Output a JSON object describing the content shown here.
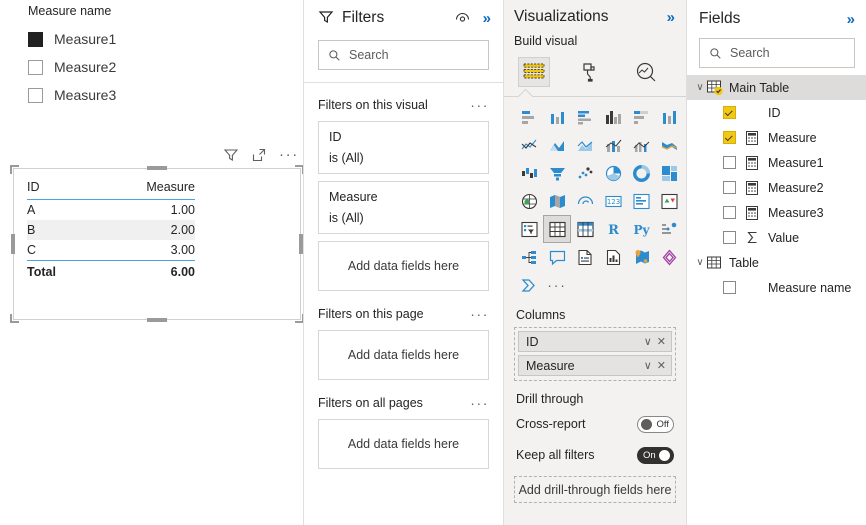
{
  "canvas": {
    "slicer": {
      "title": "Measure name",
      "items": [
        {
          "label": "Measure1",
          "checked": true
        },
        {
          "label": "Measure2",
          "checked": false
        },
        {
          "label": "Measure3",
          "checked": false
        }
      ]
    },
    "visual_header": {
      "filter_icon": "filter-icon",
      "focus_icon": "focus-mode-icon",
      "more_label": "···"
    },
    "table_visual": {
      "columns": [
        "ID",
        "Measure"
      ],
      "rows": [
        {
          "id": "A",
          "measure": "1.00"
        },
        {
          "id": "B",
          "measure": "2.00"
        },
        {
          "id": "C",
          "measure": "3.00"
        }
      ],
      "total": {
        "id": "Total",
        "measure": "6.00"
      }
    }
  },
  "filters": {
    "title": "Filters",
    "hide_icon": "eye-icon",
    "collapse_icon": "»",
    "search": {
      "placeholder": "Search"
    },
    "groups": [
      {
        "title": "Filters on this visual",
        "menu": "···",
        "cards": [
          {
            "field": "ID",
            "condition": "is (All)"
          },
          {
            "field": "Measure",
            "condition": "is (All)"
          }
        ],
        "dropzone": "Add data fields here"
      },
      {
        "title": "Filters on this page",
        "menu": "···",
        "cards": [],
        "dropzone": "Add data fields here"
      },
      {
        "title": "Filters on all pages",
        "menu": "···",
        "cards": [],
        "dropzone": "Add data fields here"
      }
    ]
  },
  "visualizations": {
    "title": "Visualizations",
    "collapse_icon": "»",
    "build_label": "Build visual",
    "tabs": [
      {
        "name": "build-visual-tab",
        "icon": "table-fields-icon",
        "selected": true
      },
      {
        "name": "format-visual-tab",
        "icon": "paint-roller-icon",
        "selected": false
      },
      {
        "name": "analytics-tab",
        "icon": "magnifier-chart-icon",
        "selected": false
      }
    ],
    "visual_types": [
      "stacked-bar-chart-icon",
      "stacked-column-chart-icon",
      "clustered-bar-chart-icon",
      "clustered-column-chart-icon",
      "hundred-percent-stacked-bar-chart-icon",
      "hundred-percent-stacked-column-chart-icon",
      "line-chart-icon",
      "area-chart-icon",
      "stacked-area-chart-icon",
      "line-stacked-column-chart-icon",
      "line-clustered-column-chart-icon",
      "ribbon-chart-icon",
      "waterfall-chart-icon",
      "funnel-chart-icon",
      "scatter-chart-icon",
      "pie-chart-icon",
      "donut-chart-icon",
      "treemap-icon",
      "map-icon",
      "filled-map-icon",
      "azure-map-icon",
      "card-icon",
      "multi-row-card-icon",
      "kpi-icon",
      "slicer-icon",
      "table-icon",
      "matrix-icon",
      "r-script-visual-icon",
      "python-visual-icon",
      "key-influencers-icon",
      "decomposition-tree-icon",
      "qna-icon",
      "smart-narrative-icon",
      "paginated-report-icon",
      "arcgis-map-icon",
      "power-apps-icon",
      "power-automate-icon",
      "more-visuals-icon"
    ],
    "selected_visual_type": "table-icon",
    "columns_well": {
      "label": "Columns",
      "fields": [
        {
          "name": "ID",
          "chevron": "∨",
          "remove": "✕"
        },
        {
          "name": "Measure",
          "chevron": "∨",
          "remove": "✕"
        }
      ]
    },
    "drill_through": {
      "title": "Drill through",
      "cross_report": {
        "label": "Cross-report",
        "state": "Off",
        "on": false
      },
      "keep_all_filters": {
        "label": "Keep all filters",
        "state": "On",
        "on": true
      },
      "dropzone": "Add drill-through fields here"
    }
  },
  "fields": {
    "title": "Fields",
    "collapse_icon": "»",
    "search": {
      "placeholder": "Search"
    },
    "tables": [
      {
        "name": "Main Table",
        "icon": "table-checked-icon",
        "selected": true,
        "expanded": true,
        "twist": "∨",
        "items": [
          {
            "label": "ID",
            "checked": true,
            "icon": ""
          },
          {
            "label": "Measure",
            "checked": true,
            "icon": "measure-icon"
          },
          {
            "label": "Measure1",
            "checked": false,
            "icon": "measure-icon"
          },
          {
            "label": "Measure2",
            "checked": false,
            "icon": "measure-icon"
          },
          {
            "label": "Measure3",
            "checked": false,
            "icon": "measure-icon"
          },
          {
            "label": "Value",
            "checked": false,
            "icon": "sum-icon"
          }
        ]
      },
      {
        "name": "Table",
        "icon": "table-icon",
        "selected": false,
        "expanded": true,
        "twist": "∨",
        "items": [
          {
            "label": "Measure name",
            "checked": false,
            "icon": ""
          }
        ]
      }
    ]
  },
  "colors": {
    "accent_yellow": "#f2c811",
    "link_blue": "#0d6abf",
    "table_rule_blue": "#4aa3df",
    "pane_gray": "#f3f2f1",
    "alt_row": "#f0f0f0"
  }
}
